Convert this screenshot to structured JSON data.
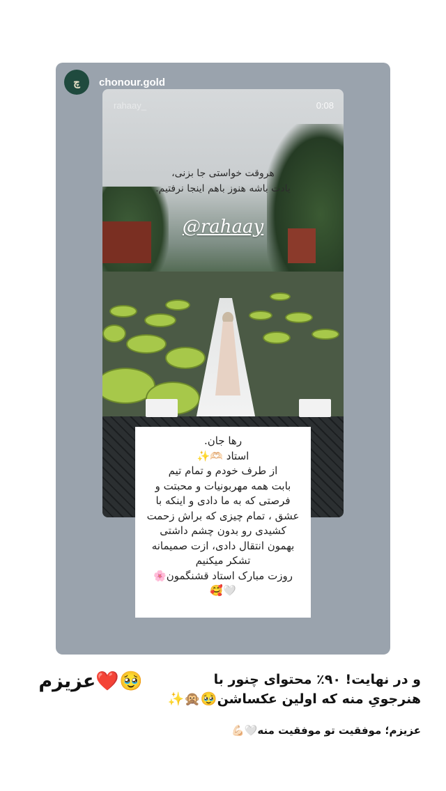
{
  "story": {
    "username": "chonour.gold",
    "avatar_text": "چ"
  },
  "reel": {
    "username": "rahaay_",
    "time": "0:08",
    "quote_lines": [
      "هروقت خواستی جا بزنی،",
      "یادت باشه هنوز باهم اینجا نرفتیم."
    ],
    "handle": "@rahaay"
  },
  "note": {
    "lines": [
      "رها جان.",
      "استاد 🫶🏻✨",
      "از طرف خودم و تمام تیم",
      "بابت همه مهربونیات و محبتت و",
      "فرصتی که به ما دادی و اینکه با",
      "عشق ، تمام چیزی که براش زحمت",
      "کشیدی رو بدون چشم داشتی",
      "بهمون انتقال دادی، ازت صمیمانه",
      "تشکر میکنیم",
      "روزت مبارک استاد قشنگمون🌸",
      "🤍🥰"
    ]
  },
  "caption": {
    "left": "🥹❤️عزیزم",
    "right_lines": [
      "و در نهایت! ۹۰٪ محتوای چنور با",
      "هنرجویِ منه که اولین عکساشن🥹🙊✨"
    ],
    "bottom": "عزیزم؛ موفقیت تو موفقیت منه🤍💪🏻"
  }
}
